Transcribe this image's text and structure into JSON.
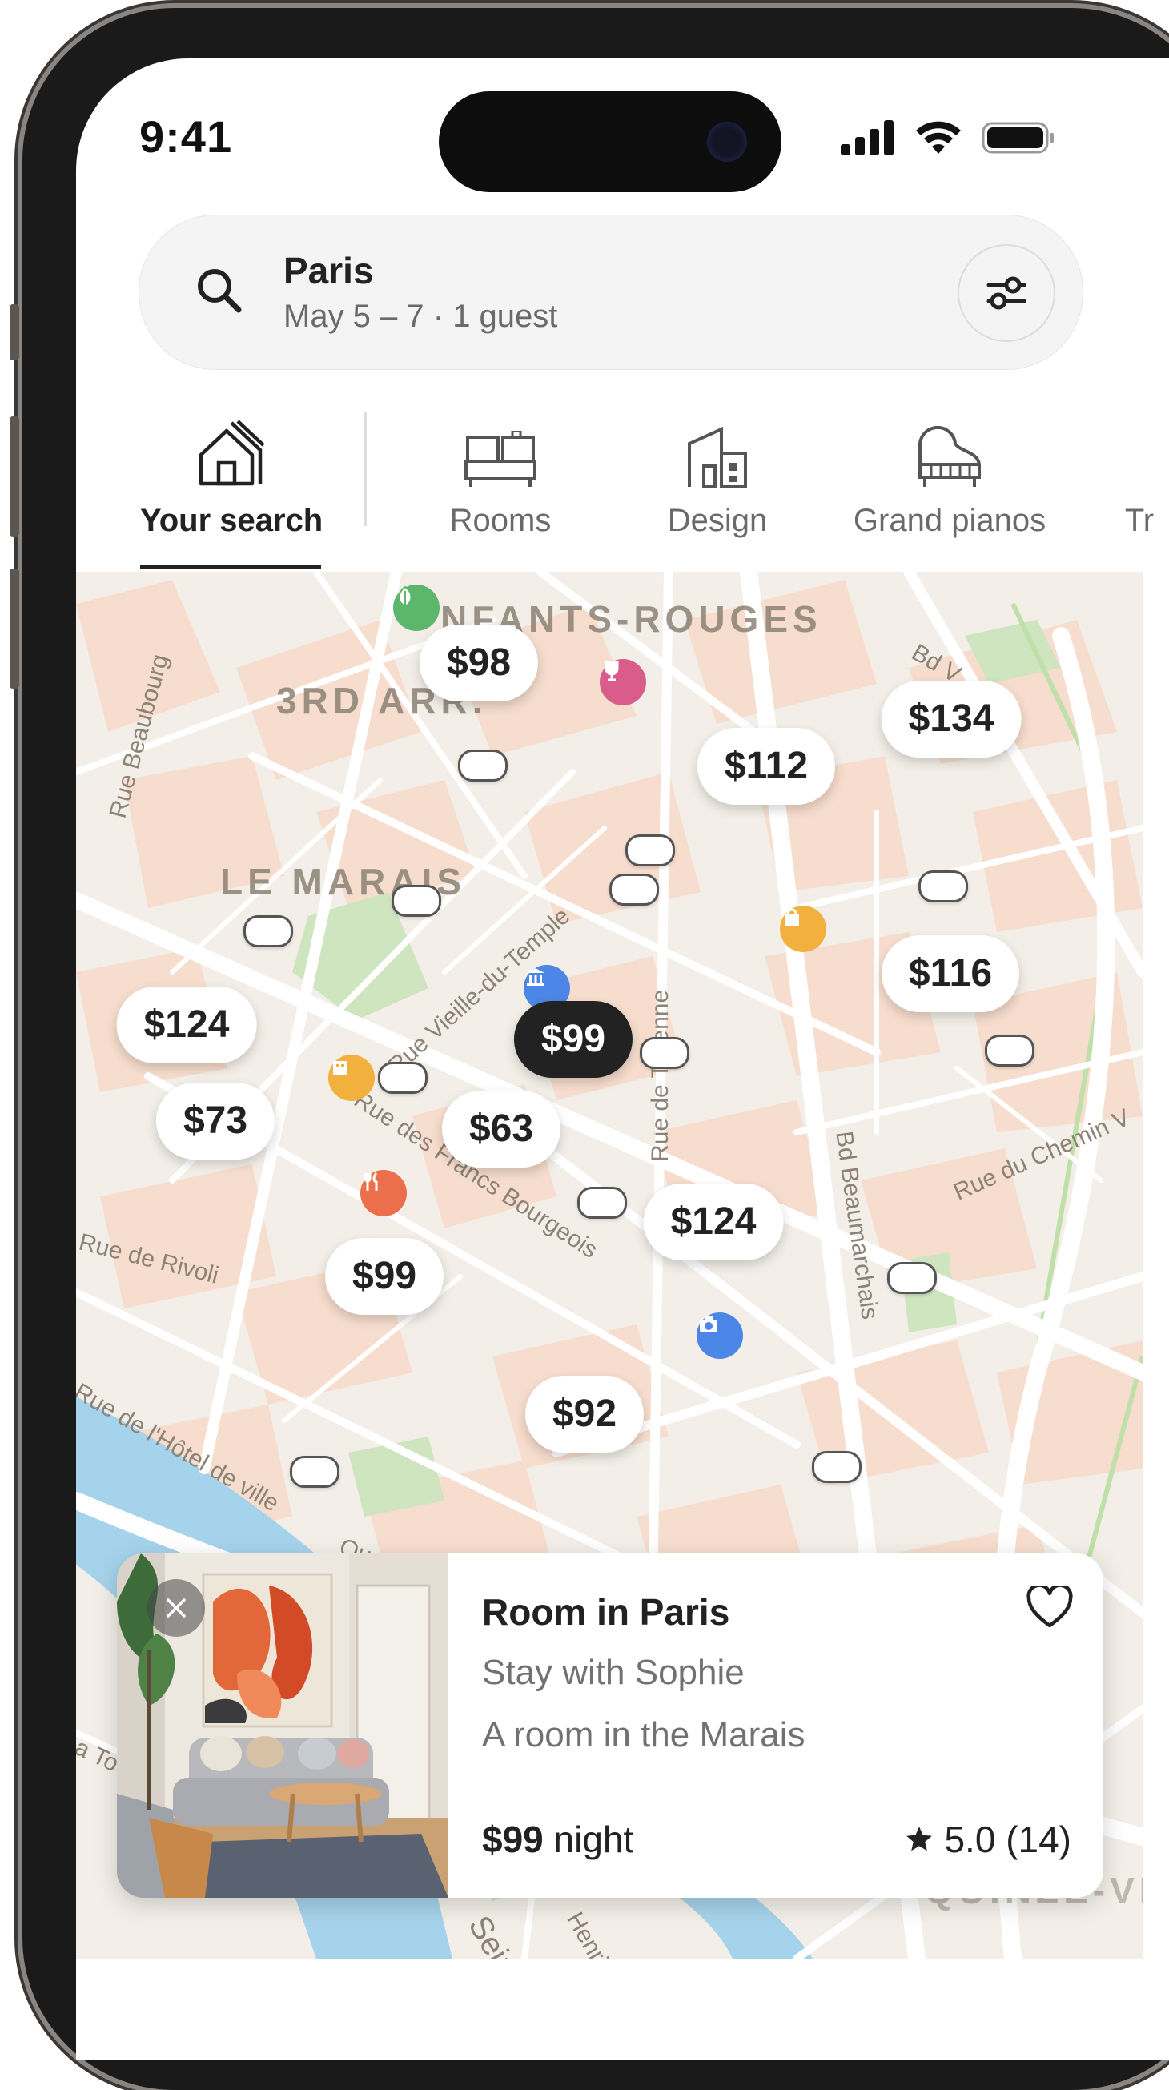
{
  "status_bar": {
    "time": "9:41"
  },
  "search": {
    "location": "Paris",
    "details": "May 5 – 7 · 1 guest"
  },
  "categories": [
    {
      "label": "Your search",
      "icon": "house-icon",
      "active": true
    },
    {
      "label": "Rooms",
      "icon": "bed-icon"
    },
    {
      "label": "Design",
      "icon": "building-icon"
    },
    {
      "label": "Grand pianos",
      "icon": "piano-icon"
    },
    {
      "label": "Tr",
      "icon": "truncated"
    }
  ],
  "map": {
    "district_labels": [
      "NFANTS-ROUGES",
      "3RD ARR.",
      "LE MARAIS",
      "QUINZE-VI"
    ],
    "streets": [
      "Rue Beaubourg",
      "Rue Vieille-du-Temple",
      "Rue des Francs Bourgeois",
      "Rue de Rivoli",
      "Rue de Turenne",
      "Bd Beaumarchais",
      "Rue du Chemin V",
      "Rue de l'Hôtel de ville",
      "Bd V",
      "Seine",
      "Henri IV",
      "Qu",
      "a To"
    ],
    "price_pins": [
      "$98",
      "$134",
      "$112",
      "$116",
      "$124",
      "$99",
      "$73",
      "$63",
      "$124",
      "$99",
      "$92"
    ],
    "selected_pin": "$99"
  },
  "listing_card": {
    "title": "Room in Paris",
    "subtitle": "Stay with Sophie",
    "description": "A room in the Marais",
    "price": "$99",
    "price_unit": "night",
    "rating": "5.0 (14)"
  },
  "colors": {
    "selected_pin": "#222222",
    "map_bg": "#f3efe8",
    "park": "#cfe5c0",
    "water": "#a6d3ec",
    "block": "#f6dccd"
  }
}
